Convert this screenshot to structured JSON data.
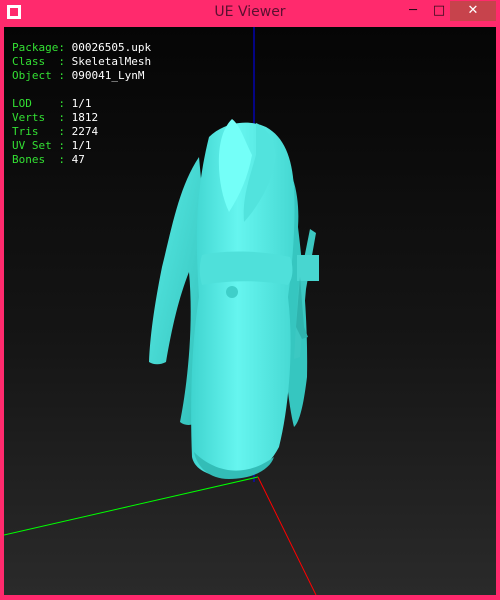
{
  "window": {
    "title": "UE Viewer",
    "minimize_glyph": "─",
    "maximize_glyph": "□",
    "close_glyph": "✕"
  },
  "info": {
    "group1": [
      {
        "key": "Package: ",
        "value": "00026505.upk"
      },
      {
        "key": "Class  : ",
        "value": "SkeletalMesh"
      },
      {
        "key": "Object : ",
        "value": "090041_LynM"
      }
    ],
    "group2": [
      {
        "key": "LOD    : ",
        "value": "1/1"
      },
      {
        "key": "Verts  : ",
        "value": "1812"
      },
      {
        "key": "Tris   : ",
        "value": "2274"
      },
      {
        "key": "UV Set : ",
        "value": "1/1"
      },
      {
        "key": "Bones  : ",
        "value": "47"
      }
    ]
  },
  "colors": {
    "frame": "#ff2a6d",
    "close_button": "#c7434c",
    "label": "#33e033",
    "value": "#ffffff",
    "mesh": "#5ef2ec",
    "axis_x": "#ff0000",
    "axis_y": "#00ff00",
    "axis_z": "#0000ff"
  }
}
